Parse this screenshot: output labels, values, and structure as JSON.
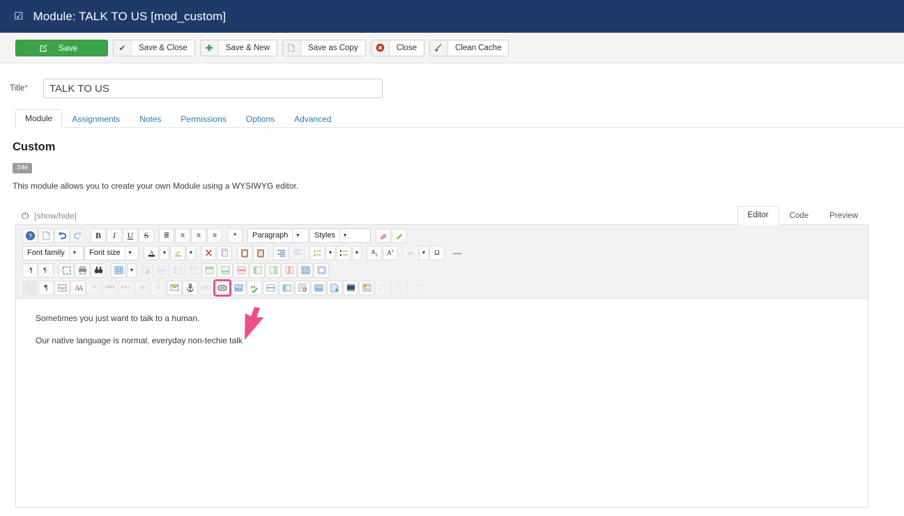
{
  "header": {
    "check_icon": "☑",
    "title": "Module: TALK TO US [mod_custom]",
    "bg_color": "#1f3a68"
  },
  "toolbar": {
    "buttons": [
      {
        "name": "save",
        "label": "Save",
        "icon": "pencil-square-icon",
        "primary": true
      },
      {
        "name": "save-close",
        "label": "Save & Close",
        "icon": "check-icon"
      },
      {
        "name": "save-new",
        "label": "Save & New",
        "icon": "plus-icon"
      },
      {
        "name": "save-copy",
        "label": "Save as Copy",
        "icon": "copy-icon"
      },
      {
        "name": "close",
        "label": "Close",
        "icon": "close-circle-icon"
      },
      {
        "name": "clean-cache",
        "label": "Clean Cache",
        "icon": "broom-icon"
      }
    ]
  },
  "title_field": {
    "label": "Title",
    "required_marker": "*",
    "value": "TALK TO US",
    "placeholder": "Title"
  },
  "tabs": {
    "items": [
      {
        "label": "Module",
        "active": true
      },
      {
        "label": "Assignments",
        "active": false
      },
      {
        "label": "Notes",
        "active": false
      },
      {
        "label": "Permissions",
        "active": false
      },
      {
        "label": "Options",
        "active": false
      },
      {
        "label": "Advanced",
        "active": false
      }
    ]
  },
  "module_panel": {
    "heading": "Custom",
    "badge": "Site",
    "description": "This module allows you to create your own Module using a WYSIWYG editor."
  },
  "editor": {
    "show_hide_label": "[show/hide]",
    "power_icon": "⏻",
    "tabs": [
      {
        "label": "Editor",
        "active": true
      },
      {
        "label": "Code",
        "active": false
      },
      {
        "label": "Preview",
        "active": false
      }
    ],
    "selects": {
      "paragraph": "Paragraph",
      "styles": "Styles",
      "font_family": "Font family",
      "font_size": "Font size"
    },
    "highlighted_button": "insert-edit-link-button",
    "highlight_color": "#ef4d8d",
    "content_paragraphs": [
      "Sometimes you just want to talk to a human.",
      "Our native language is normal, everyday non-techie talk"
    ]
  }
}
